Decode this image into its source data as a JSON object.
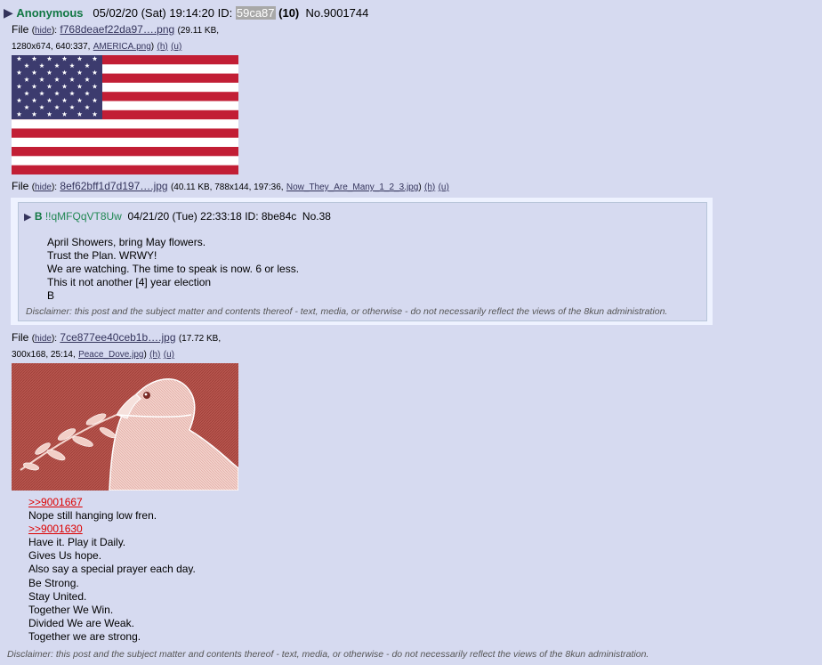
{
  "post": {
    "arrow": "▶",
    "name": "Anonymous",
    "date": "05/02/20 (Sat) 19:14:20",
    "id_label": "ID:",
    "id": "59ca87",
    "reply_count": "(10)",
    "number": "No.9001744"
  },
  "files": [
    {
      "label": "File",
      "hide": "hide",
      "filename": "f768deaef22da97….png",
      "meta_a": "(29.11 KB,",
      "meta_b": "1280x674, 640:337,",
      "orig": "AMERICA.png",
      "h": "(h)",
      "u": "(u)"
    },
    {
      "label": "File",
      "hide": "hide",
      "filename": "8ef62bff1d7d197….jpg",
      "meta_a": "(40.11 KB, 788x144, 197:36,",
      "orig": "Now_They_Are_Many_1_2_3.jpg",
      "h": "(h)",
      "u": "(u)"
    },
    {
      "label": "File",
      "hide": "hide",
      "filename": "7ce877ee40ceb1b….jpg",
      "meta_a": "(17.72 KB,",
      "meta_b": "300x168, 25:14,",
      "orig": "Peace_Dove.jpg",
      "h": "(h)",
      "u": "(u)"
    }
  ],
  "quoted_post": {
    "arrow": "▶",
    "name": "B",
    "trip": "!!qMFQqVT8Uw",
    "date": "04/21/20 (Tue) 22:33:18",
    "id_label": "ID:",
    "id": "8be84c",
    "number": "No.38",
    "lines": [
      "April Showers, bring May flowers.",
      "Trust the Plan. WRWY!",
      "We are watching. The time to speak is now. 6 or less.",
      "This it not another [4] year election",
      "B"
    ],
    "disclaimer": "Disclaimer: this post and the subject matter and contents thereof - text, media, or otherwise - do not necessarily reflect the views of the 8kun administration."
  },
  "body": {
    "link1": ">>9001667",
    "line1": "Nope still hanging low fren.",
    "link2": ">>9001630",
    "lines": [
      "Have it. Play it Daily.",
      "Gives Us hope.",
      "Also say a special prayer each day.",
      "Be Strong.",
      "Stay United.",
      "Together We Win.",
      "Divided We are Weak.",
      "Together we are strong."
    ]
  },
  "disclaimer": "Disclaimer: this post and the subject matter and contents thereof - text, media, or otherwise - do not necessarily reflect the views of the 8kun administration.",
  "colors": {
    "background": "#d6daf0",
    "name": "#117743",
    "link": "#34345c",
    "quote_link": "#dd0000"
  }
}
